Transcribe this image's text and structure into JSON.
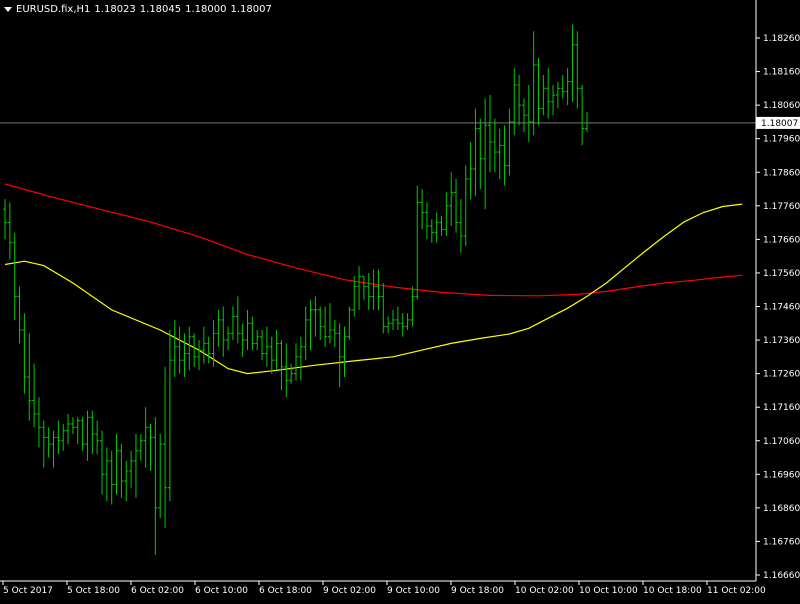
{
  "header": {
    "symbol": "EURUSD.fix,H1",
    "open": "1.18023",
    "high": "1.18045",
    "low": "1.18000",
    "close": "1.18007"
  },
  "colors": {
    "background": "#000000",
    "axis": "#ffffff",
    "bars": "#00cc00",
    "ma_slow": "#ff0000",
    "ma_fast": "#ffff00",
    "price_line": "#c0c0c0",
    "price_label_bg": "#ffffff",
    "price_label_text": "#000000"
  },
  "chart_data": {
    "type": "ohlc",
    "title": "",
    "xlabel": "",
    "ylabel": "",
    "ylim": [
      1.1662,
      1.1832
    ],
    "y_ticks": [
      "1.18260",
      "1.18160",
      "1.18060",
      "1.17960",
      "1.17860",
      "1.17760",
      "1.17660",
      "1.17560",
      "1.17460",
      "1.17360",
      "1.17260",
      "1.17160",
      "1.17060",
      "1.16960",
      "1.16860",
      "1.16760",
      "1.16660"
    ],
    "x_ticks": [
      "5 Oct 2017",
      "5 Oct 18:00",
      "6 Oct 02:00",
      "6 Oct 10:00",
      "6 Oct 18:00",
      "9 Oct 02:00",
      "9 Oct 10:00",
      "9 Oct 18:00",
      "10 Oct 02:00",
      "10 Oct 10:00",
      "10 Oct 18:00",
      "11 Oct 02:00"
    ],
    "current_price": "1.18007",
    "bars": [
      {
        "o": 1.1775,
        "h": 1.1778,
        "l": 1.1766,
        "c": 1.1771
      },
      {
        "o": 1.1771,
        "h": 1.1777,
        "l": 1.176,
        "c": 1.1765
      },
      {
        "o": 1.1765,
        "h": 1.1768,
        "l": 1.1742,
        "c": 1.1749
      },
      {
        "o": 1.1749,
        "h": 1.1752,
        "l": 1.1735,
        "c": 1.1739
      },
      {
        "o": 1.1739,
        "h": 1.1744,
        "l": 1.172,
        "c": 1.1725
      },
      {
        "o": 1.1725,
        "h": 1.1738,
        "l": 1.1712,
        "c": 1.1718
      },
      {
        "o": 1.1718,
        "h": 1.1729,
        "l": 1.171,
        "c": 1.1714
      },
      {
        "o": 1.1714,
        "h": 1.1719,
        "l": 1.1704,
        "c": 1.171
      },
      {
        "o": 1.171,
        "h": 1.1712,
        "l": 1.1698,
        "c": 1.1707
      },
      {
        "o": 1.1707,
        "h": 1.171,
        "l": 1.1701,
        "c": 1.1705
      },
      {
        "o": 1.1705,
        "h": 1.1709,
        "l": 1.1698,
        "c": 1.1707
      },
      {
        "o": 1.1707,
        "h": 1.1712,
        "l": 1.1702,
        "c": 1.1706
      },
      {
        "o": 1.1706,
        "h": 1.1711,
        "l": 1.1703,
        "c": 1.1709
      },
      {
        "o": 1.1709,
        "h": 1.1714,
        "l": 1.1705,
        "c": 1.1711
      },
      {
        "o": 1.1711,
        "h": 1.1713,
        "l": 1.1708,
        "c": 1.171
      },
      {
        "o": 1.171,
        "h": 1.1713,
        "l": 1.1705,
        "c": 1.1712
      },
      {
        "o": 1.1712,
        "h": 1.1713,
        "l": 1.1703,
        "c": 1.1705
      },
      {
        "o": 1.1705,
        "h": 1.1715,
        "l": 1.17,
        "c": 1.1713
      },
      {
        "o": 1.1713,
        "h": 1.1715,
        "l": 1.1702,
        "c": 1.1708
      },
      {
        "o": 1.1708,
        "h": 1.1712,
        "l": 1.1702,
        "c": 1.1706
      },
      {
        "o": 1.1706,
        "h": 1.1709,
        "l": 1.169,
        "c": 1.1696
      },
      {
        "o": 1.1696,
        "h": 1.1704,
        "l": 1.1688,
        "c": 1.17
      },
      {
        "o": 1.17,
        "h": 1.1703,
        "l": 1.1687,
        "c": 1.1693
      },
      {
        "o": 1.1693,
        "h": 1.1708,
        "l": 1.169,
        "c": 1.1703
      },
      {
        "o": 1.1703,
        "h": 1.1705,
        "l": 1.1689,
        "c": 1.1694
      },
      {
        "o": 1.1694,
        "h": 1.17,
        "l": 1.1688,
        "c": 1.1697
      },
      {
        "o": 1.1697,
        "h": 1.1703,
        "l": 1.1692,
        "c": 1.17
      },
      {
        "o": 1.17,
        "h": 1.1708,
        "l": 1.1689,
        "c": 1.1703
      },
      {
        "o": 1.1703,
        "h": 1.1708,
        "l": 1.17,
        "c": 1.1706
      },
      {
        "o": 1.1706,
        "h": 1.1716,
        "l": 1.1698,
        "c": 1.171
      },
      {
        "o": 1.171,
        "h": 1.1711,
        "l": 1.1697,
        "c": 1.1707
      },
      {
        "o": 1.1707,
        "h": 1.1713,
        "l": 1.1672,
        "c": 1.1686
      },
      {
        "o": 1.1686,
        "h": 1.1708,
        "l": 1.1683,
        "c": 1.1705
      },
      {
        "o": 1.1705,
        "h": 1.1728,
        "l": 1.168,
        "c": 1.1692
      },
      {
        "o": 1.1692,
        "h": 1.1739,
        "l": 1.1688,
        "c": 1.173
      },
      {
        "o": 1.173,
        "h": 1.1742,
        "l": 1.1725,
        "c": 1.1734
      },
      {
        "o": 1.1734,
        "h": 1.174,
        "l": 1.1726,
        "c": 1.173
      },
      {
        "o": 1.173,
        "h": 1.1738,
        "l": 1.1725,
        "c": 1.1732
      },
      {
        "o": 1.1732,
        "h": 1.174,
        "l": 1.1727,
        "c": 1.1737
      },
      {
        "o": 1.1737,
        "h": 1.1738,
        "l": 1.1728,
        "c": 1.1731
      },
      {
        "o": 1.1731,
        "h": 1.1736,
        "l": 1.1727,
        "c": 1.1733
      },
      {
        "o": 1.1733,
        "h": 1.174,
        "l": 1.1729,
        "c": 1.1735
      },
      {
        "o": 1.1735,
        "h": 1.1737,
        "l": 1.1729,
        "c": 1.1732
      },
      {
        "o": 1.1732,
        "h": 1.1742,
        "l": 1.1728,
        "c": 1.1738
      },
      {
        "o": 1.1738,
        "h": 1.1745,
        "l": 1.1734,
        "c": 1.1742
      },
      {
        "o": 1.1742,
        "h": 1.1746,
        "l": 1.1731,
        "c": 1.1736
      },
      {
        "o": 1.1736,
        "h": 1.174,
        "l": 1.1733,
        "c": 1.1738
      },
      {
        "o": 1.1738,
        "h": 1.1746,
        "l": 1.1736,
        "c": 1.1743
      },
      {
        "o": 1.1743,
        "h": 1.1749,
        "l": 1.1735,
        "c": 1.1738
      },
      {
        "o": 1.1738,
        "h": 1.1741,
        "l": 1.1731,
        "c": 1.1736
      },
      {
        "o": 1.1736,
        "h": 1.1745,
        "l": 1.1733,
        "c": 1.1741
      },
      {
        "o": 1.1741,
        "h": 1.1743,
        "l": 1.1733,
        "c": 1.1735
      },
      {
        "o": 1.1735,
        "h": 1.1739,
        "l": 1.1733,
        "c": 1.1737
      },
      {
        "o": 1.1737,
        "h": 1.1739,
        "l": 1.173,
        "c": 1.1732
      },
      {
        "o": 1.1732,
        "h": 1.174,
        "l": 1.1728,
        "c": 1.1734
      },
      {
        "o": 1.1734,
        "h": 1.1737,
        "l": 1.1726,
        "c": 1.173
      },
      {
        "o": 1.173,
        "h": 1.1739,
        "l": 1.1727,
        "c": 1.1735
      },
      {
        "o": 1.1735,
        "h": 1.1736,
        "l": 1.1721,
        "c": 1.1728
      },
      {
        "o": 1.1728,
        "h": 1.1735,
        "l": 1.1719,
        "c": 1.1724
      },
      {
        "o": 1.1724,
        "h": 1.1729,
        "l": 1.1723,
        "c": 1.1726
      },
      {
        "o": 1.1726,
        "h": 1.1735,
        "l": 1.1724,
        "c": 1.1731
      },
      {
        "o": 1.1731,
        "h": 1.1737,
        "l": 1.1724,
        "c": 1.1734
      },
      {
        "o": 1.1734,
        "h": 1.1746,
        "l": 1.173,
        "c": 1.1742
      },
      {
        "o": 1.1742,
        "h": 1.1748,
        "l": 1.1733,
        "c": 1.1745
      },
      {
        "o": 1.1745,
        "h": 1.1749,
        "l": 1.1737,
        "c": 1.1745
      },
      {
        "o": 1.1745,
        "h": 1.1746,
        "l": 1.1736,
        "c": 1.174
      },
      {
        "o": 1.174,
        "h": 1.1746,
        "l": 1.1734,
        "c": 1.1737
      },
      {
        "o": 1.1737,
        "h": 1.1747,
        "l": 1.1735,
        "c": 1.1739
      },
      {
        "o": 1.1739,
        "h": 1.1742,
        "l": 1.1734,
        "c": 1.1738
      },
      {
        "o": 1.1738,
        "h": 1.1741,
        "l": 1.1722,
        "c": 1.1731
      },
      {
        "o": 1.1731,
        "h": 1.174,
        "l": 1.1725,
        "c": 1.1737
      },
      {
        "o": 1.1737,
        "h": 1.1746,
        "l": 1.1736,
        "c": 1.1745
      },
      {
        "o": 1.1745,
        "h": 1.1755,
        "l": 1.1743,
        "c": 1.1752
      },
      {
        "o": 1.1752,
        "h": 1.1758,
        "l": 1.1745,
        "c": 1.1755
      },
      {
        "o": 1.1755,
        "h": 1.1755,
        "l": 1.1748,
        "c": 1.1752
      },
      {
        "o": 1.1752,
        "h": 1.1756,
        "l": 1.1745,
        "c": 1.1749
      },
      {
        "o": 1.1749,
        "h": 1.1757,
        "l": 1.1745,
        "c": 1.1752
      },
      {
        "o": 1.1752,
        "h": 1.1757,
        "l": 1.1745,
        "c": 1.1749
      },
      {
        "o": 1.1749,
        "h": 1.1753,
        "l": 1.1738,
        "c": 1.174
      },
      {
        "o": 1.174,
        "h": 1.1743,
        "l": 1.1738,
        "c": 1.1741
      },
      {
        "o": 1.1741,
        "h": 1.1745,
        "l": 1.1739,
        "c": 1.1742
      },
      {
        "o": 1.1742,
        "h": 1.1746,
        "l": 1.1739,
        "c": 1.1741
      },
      {
        "o": 1.1741,
        "h": 1.1744,
        "l": 1.1737,
        "c": 1.174
      },
      {
        "o": 1.174,
        "h": 1.1744,
        "l": 1.1739,
        "c": 1.1742
      },
      {
        "o": 1.1742,
        "h": 1.1752,
        "l": 1.174,
        "c": 1.1749
      },
      {
        "o": 1.1749,
        "h": 1.1782,
        "l": 1.1748,
        "c": 1.1777
      },
      {
        "o": 1.1777,
        "h": 1.1781,
        "l": 1.1769,
        "c": 1.1774
      },
      {
        "o": 1.1774,
        "h": 1.1777,
        "l": 1.1766,
        "c": 1.177
      },
      {
        "o": 1.177,
        "h": 1.1772,
        "l": 1.1765,
        "c": 1.1768
      },
      {
        "o": 1.1768,
        "h": 1.1774,
        "l": 1.1765,
        "c": 1.1771
      },
      {
        "o": 1.1771,
        "h": 1.1773,
        "l": 1.1767,
        "c": 1.1769
      },
      {
        "o": 1.1769,
        "h": 1.178,
        "l": 1.1767,
        "c": 1.1776
      },
      {
        "o": 1.1776,
        "h": 1.1786,
        "l": 1.177,
        "c": 1.178
      },
      {
        "o": 1.178,
        "h": 1.1784,
        "l": 1.1768,
        "c": 1.1771
      },
      {
        "o": 1.1771,
        "h": 1.1778,
        "l": 1.1762,
        "c": 1.1767
      },
      {
        "o": 1.1767,
        "h": 1.1788,
        "l": 1.1764,
        "c": 1.1784
      },
      {
        "o": 1.1784,
        "h": 1.1795,
        "l": 1.1778,
        "c": 1.1787
      },
      {
        "o": 1.1787,
        "h": 1.1805,
        "l": 1.1779,
        "c": 1.1799
      },
      {
        "o": 1.1799,
        "h": 1.1802,
        "l": 1.1781,
        "c": 1.179
      },
      {
        "o": 1.179,
        "h": 1.1808,
        "l": 1.1775,
        "c": 1.18
      },
      {
        "o": 1.18,
        "h": 1.1809,
        "l": 1.1786,
        "c": 1.1795
      },
      {
        "o": 1.1795,
        "h": 1.1802,
        "l": 1.1786,
        "c": 1.1792
      },
      {
        "o": 1.1792,
        "h": 1.1799,
        "l": 1.1784,
        "c": 1.1794
      },
      {
        "o": 1.1794,
        "h": 1.18,
        "l": 1.1782,
        "c": 1.1788
      },
      {
        "o": 1.1788,
        "h": 1.1805,
        "l": 1.1785,
        "c": 1.1801
      },
      {
        "o": 1.1801,
        "h": 1.1817,
        "l": 1.1797,
        "c": 1.1812
      },
      {
        "o": 1.1812,
        "h": 1.1815,
        "l": 1.18,
        "c": 1.1806
      },
      {
        "o": 1.1806,
        "h": 1.1808,
        "l": 1.1798,
        "c": 1.1803
      },
      {
        "o": 1.1803,
        "h": 1.1812,
        "l": 1.1795,
        "c": 1.1801
      },
      {
        "o": 1.1801,
        "h": 1.1828,
        "l": 1.1797,
        "c": 1.1818
      },
      {
        "o": 1.1818,
        "h": 1.182,
        "l": 1.18,
        "c": 1.1805
      },
      {
        "o": 1.1805,
        "h": 1.1815,
        "l": 1.1803,
        "c": 1.1811
      },
      {
        "o": 1.1811,
        "h": 1.1817,
        "l": 1.1802,
        "c": 1.1807
      },
      {
        "o": 1.1807,
        "h": 1.1812,
        "l": 1.1803,
        "c": 1.1809
      },
      {
        "o": 1.1809,
        "h": 1.1813,
        "l": 1.1805,
        "c": 1.1811
      },
      {
        "o": 1.1811,
        "h": 1.1815,
        "l": 1.1808,
        "c": 1.181
      },
      {
        "o": 1.181,
        "h": 1.1817,
        "l": 1.1806,
        "c": 1.1813
      },
      {
        "o": 1.1813,
        "h": 1.183,
        "l": 1.1807,
        "c": 1.1824
      },
      {
        "o": 1.1824,
        "h": 1.1828,
        "l": 1.1805,
        "c": 1.1811
      },
      {
        "o": 1.1811,
        "h": 1.1812,
        "l": 1.1794,
        "c": 1.1799
      },
      {
        "o": 1.1799,
        "h": 1.1804,
        "l": 1.1798,
        "c": 1.18007
      }
    ],
    "series": [
      {
        "type": "line",
        "color": "#ff0000",
        "points": [
          [
            0,
            1.17825
          ],
          [
            10,
            1.17785
          ],
          [
            20,
            1.17748
          ],
          [
            30,
            1.17712
          ],
          [
            40,
            1.17668
          ],
          [
            50,
            1.17615
          ],
          [
            60,
            1.17575
          ],
          [
            70,
            1.1754
          ],
          [
            80,
            1.17518
          ],
          [
            90,
            1.17502
          ],
          [
            100,
            1.17493
          ],
          [
            110,
            1.17492
          ],
          [
            118,
            1.17496
          ],
          [
            124,
            1.17505
          ],
          [
            130,
            1.17518
          ],
          [
            136,
            1.1753
          ],
          [
            142,
            1.17538
          ],
          [
            148,
            1.17548
          ],
          [
            152,
            1.17553
          ]
        ]
      },
      {
        "type": "line",
        "color": "#ffff00",
        "points": [
          [
            0,
            1.17585
          ],
          [
            4,
            1.17595
          ],
          [
            8,
            1.17582
          ],
          [
            14,
            1.1753
          ],
          [
            22,
            1.1745
          ],
          [
            32,
            1.1739
          ],
          [
            40,
            1.1733
          ],
          [
            46,
            1.17275
          ],
          [
            50,
            1.1726
          ],
          [
            56,
            1.1727
          ],
          [
            64,
            1.17285
          ],
          [
            72,
            1.17298
          ],
          [
            80,
            1.1731
          ],
          [
            86,
            1.1733
          ],
          [
            92,
            1.1735
          ],
          [
            98,
            1.17365
          ],
          [
            104,
            1.17378
          ],
          [
            108,
            1.17395
          ],
          [
            112,
            1.17425
          ],
          [
            116,
            1.17455
          ],
          [
            120,
            1.1749
          ],
          [
            124,
            1.1753
          ],
          [
            128,
            1.17578
          ],
          [
            132,
            1.17625
          ],
          [
            136,
            1.1767
          ],
          [
            140,
            1.17712
          ],
          [
            144,
            1.1774
          ],
          [
            148,
            1.17758
          ],
          [
            152,
            1.17765
          ]
        ]
      }
    ]
  }
}
